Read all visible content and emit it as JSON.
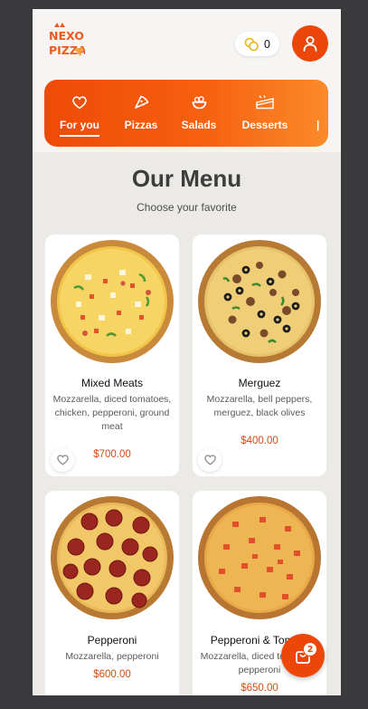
{
  "brand": {
    "logo_text_top": "NEXO",
    "logo_text_bottom": "PIZZA"
  },
  "header": {
    "coins_count": "0"
  },
  "categories": [
    {
      "label": "For you",
      "icon": "heart-icon",
      "active": true
    },
    {
      "label": "Pizzas",
      "icon": "pizza-slice-icon",
      "active": false
    },
    {
      "label": "Salads",
      "icon": "salad-bowl-icon",
      "active": false
    },
    {
      "label": "Desserts",
      "icon": "cake-icon",
      "active": false
    }
  ],
  "menu": {
    "title": "Our Menu",
    "subtitle": "Choose your favorite"
  },
  "products": [
    {
      "name": "Mixed Meats",
      "description": "Mozzarella, diced tomatoes, chicken, pepperoni, ground meat",
      "price": "$700.00"
    },
    {
      "name": "Merguez",
      "description": "Mozzarella, bell peppers, merguez, black olives",
      "price": "$400.00"
    },
    {
      "name": "Pepperoni",
      "description": "Mozzarella, pepperoni",
      "price": "$600.00"
    },
    {
      "name": "Pepperoni & Tomato",
      "description": "Mozzarella, diced tomatoes, pepperoni",
      "price": "$650.00"
    }
  ],
  "cart": {
    "count": "2"
  },
  "colors": {
    "accent": "#ec4708",
    "price": "#d9480a",
    "page_bg": "#eceae6"
  }
}
